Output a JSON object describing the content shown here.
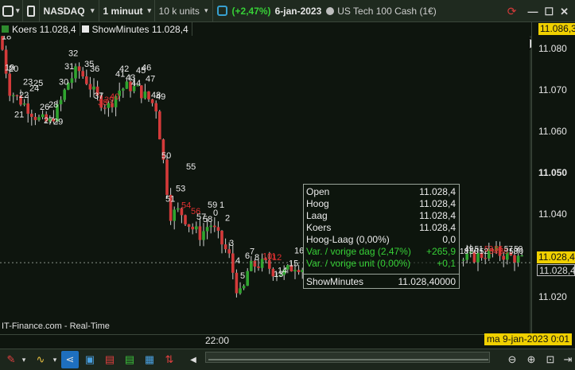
{
  "toolbar": {
    "symbol": "NASDAQ",
    "timeframe": "1 minuut",
    "units": "10 k units",
    "change": "(+2,47%)",
    "date": "6-jan-2023",
    "instrument": "US Tech 100 Cash (1€)",
    "market_dot_color": "#cfcfcf",
    "window_buttons": [
      "minimize-icon",
      "restore-icon",
      "close-icon"
    ]
  },
  "legend": [
    {
      "label": "Koers 11.028,4",
      "color": "#2e8b2e"
    },
    {
      "label": "ShowMinutes 11.028,4",
      "color": "#e8e8e8"
    }
  ],
  "price_axis": {
    "ticks": [
      "11.080",
      "11.070",
      "11.060",
      "11.050",
      "11.040",
      "11.030",
      "11.020"
    ],
    "bold_tick": "11.050",
    "top_label": "11.086,3",
    "last_price": "11.028,4",
    "last_price_2": "11.028,4"
  },
  "time_axis": {
    "ticks": [
      "22:00"
    ]
  },
  "date_badge": "ma 9-jan-2023 0:01",
  "source": "IT-Finance.com - Real-Time",
  "tooltip": {
    "rows": [
      {
        "label": "Open",
        "value": "11.028,4"
      },
      {
        "label": "Hoog",
        "value": "11.028,4"
      },
      {
        "label": "Laag",
        "value": "11.028,4"
      },
      {
        "label": "Koers",
        "value": "11.028,4"
      },
      {
        "label": "Hoog-Laag (0,00%)",
        "value": "0,0"
      },
      {
        "label": "Var. / vorige dag (2,47%)",
        "value": "+265,9"
      },
      {
        "label": "Var. / vorige unit (0,00%)",
        "value": "+0,1"
      }
    ],
    "footer": {
      "label": "ShowMinutes",
      "value": "11.028,40000"
    }
  },
  "colors": {
    "up": "#2fa52f",
    "down": "#d43a3a",
    "bg": "#0e150e"
  },
  "chart_data": {
    "type": "candlestick",
    "title": "",
    "y_ticks": [
      "11.080",
      "11.070",
      "11.060",
      "11.050",
      "11.040",
      "11.030",
      "11.020"
    ],
    "x_ticks": [
      "22:00"
    ],
    "minute_labels_white": [
      {
        "label": "18",
        "price": 11082.2
      },
      {
        "label": "19",
        "price": 11074.7
      },
      {
        "label": "20",
        "price": 11074.4
      },
      {
        "label": "21",
        "price": 11063.4
      },
      {
        "label": "22",
        "price": 11068.1
      },
      {
        "label": "23",
        "price": 11071.3
      },
      {
        "label": "24",
        "price": 11069.7
      },
      {
        "label": "25",
        "price": 11071.0
      },
      {
        "label": "26",
        "price": 11065.2
      },
      {
        "label": "27",
        "price": 11062.0
      },
      {
        "label": "28",
        "price": 11065.8
      },
      {
        "label": "29",
        "price": 11061.7
      },
      {
        "label": "30",
        "price": 11071.3
      },
      {
        "label": "31",
        "price": 11075.0
      },
      {
        "label": "32",
        "price": 11078.2
      },
      {
        "label": "35",
        "price": 11075.6
      },
      {
        "label": "36",
        "price": 11074.4
      },
      {
        "label": "37",
        "price": 11067.9
      },
      {
        "label": "41",
        "price": 11073.2
      },
      {
        "label": "42",
        "price": 11074.4
      },
      {
        "label": "43",
        "price": 11072.3
      },
      {
        "label": "44",
        "price": 11071.0
      },
      {
        "label": "45",
        "price": 11074.1
      },
      {
        "label": "46",
        "price": 11074.7
      },
      {
        "label": "47",
        "price": 11072.0
      },
      {
        "label": "48",
        "price": 11068.1
      },
      {
        "label": "49",
        "price": 11067.7
      },
      {
        "label": "50",
        "price": 11053.5
      },
      {
        "label": "51",
        "price": 11043.1
      },
      {
        "label": "53",
        "price": 11045.6
      },
      {
        "label": "55",
        "price": 11050.9
      },
      {
        "label": "57",
        "price": 11038.8
      },
      {
        "label": "58",
        "price": 11038.2
      },
      {
        "label": "59",
        "price": 11041.7
      },
      {
        "label": "1",
        "price": 11041.7
      },
      {
        "label": "0",
        "price": 11039.7
      },
      {
        "label": "2",
        "price": 11038.5
      },
      {
        "label": "3",
        "price": 11032.5
      },
      {
        "label": "4",
        "price": 11028.2
      },
      {
        "label": "5",
        "price": 11024.6
      },
      {
        "label": "6",
        "price": 11029.4
      },
      {
        "label": "7",
        "price": 11030.4
      },
      {
        "label": "8",
        "price": 11029.0
      },
      {
        "label": "13",
        "price": 11025.0
      },
      {
        "label": "14",
        "price": 11025.8
      },
      {
        "label": "15",
        "price": 11027.6
      },
      {
        "label": "16",
        "price": 11030.6
      }
    ],
    "minute_labels_red": [
      {
        "label": "38",
        "price": 11066.3
      },
      {
        "label": "39",
        "price": 11067.0
      },
      {
        "label": "40",
        "price": 11067.7
      },
      {
        "label": "54",
        "price": 11041.6
      },
      {
        "label": "56",
        "price": 11040.1
      },
      {
        "label": "10",
        "price": 11029.3
      },
      {
        "label": "11",
        "price": 11029.3
      },
      {
        "label": "12",
        "price": 11029.0
      }
    ],
    "right_cluster_labels": [
      "18",
      "49",
      "50",
      "51",
      "52",
      "53",
      "54",
      "55",
      "56",
      "57",
      "58",
      "59",
      "0"
    ],
    "last_price": 11028.4,
    "previous_close_change_pct": 2.47
  }
}
